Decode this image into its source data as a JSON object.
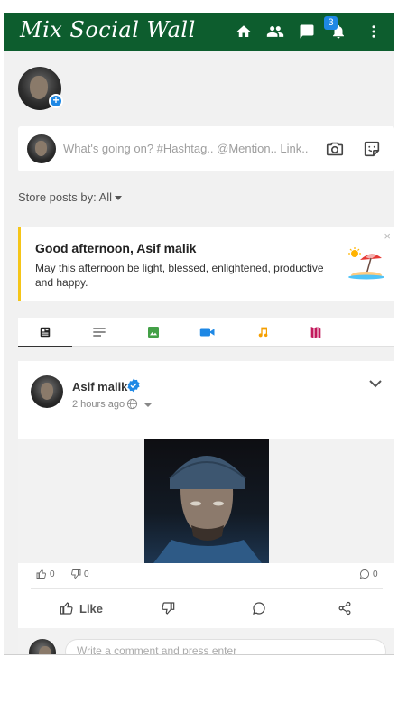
{
  "header": {
    "title": "Mix Social Wall",
    "notification_count": "3",
    "icons": [
      "home-icon",
      "friends-icon",
      "messages-icon",
      "notifications-icon",
      "more-menu-icon"
    ],
    "background_color": "#0d5d2e"
  },
  "composer": {
    "placeholder": "What's going on? #Hashtag.. @Mention.. Link..",
    "icons": [
      "camera-icon",
      "sticker-icon"
    ]
  },
  "store": {
    "label": "Store posts by: All"
  },
  "greeting": {
    "title": "Good afternoon, Asif malik",
    "text": "May this afternoon be light, blessed, enlightened, productive and happy.",
    "close": "×",
    "accent_color": "#f5c518"
  },
  "tabs": [
    {
      "icon": "all-posts-icon",
      "color": "#222222",
      "active": true
    },
    {
      "icon": "text-icon",
      "color": "#555555"
    },
    {
      "icon": "photo-icon",
      "color": "#43a047"
    },
    {
      "icon": "video-icon",
      "color": "#1e88e5"
    },
    {
      "icon": "music-icon",
      "color": "#f59f00"
    },
    {
      "icon": "map-icon",
      "color": "#c2185b"
    }
  ],
  "post": {
    "author": "Asif malik",
    "time": "2 hours ago",
    "likes": "0",
    "dislikes": "0",
    "comments": "0",
    "actions": {
      "like": "Like"
    },
    "comment_placeholder": "Write a comment and press enter"
  }
}
